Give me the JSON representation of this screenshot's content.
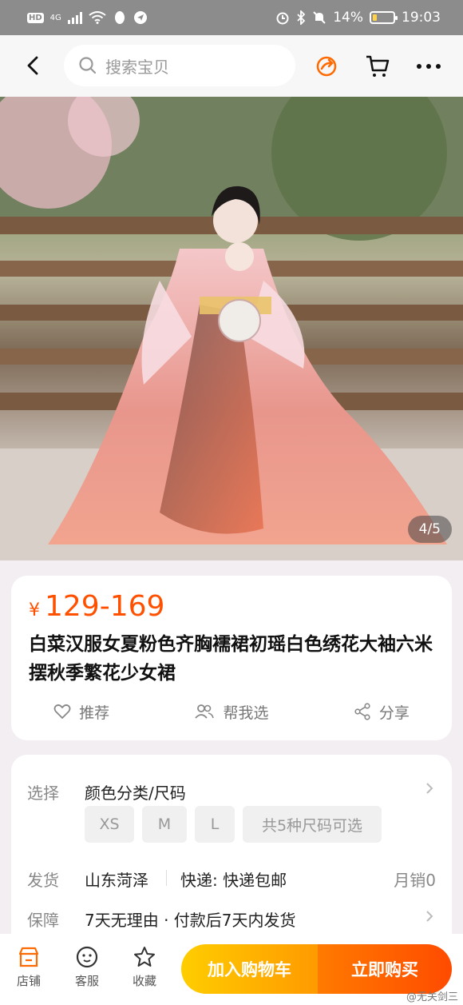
{
  "status_bar": {
    "hd": "HD",
    "network": "4G",
    "battery_percent": "14%",
    "battery_level": 0.14,
    "time": "19:03"
  },
  "header": {
    "search_placeholder": "搜索宝贝"
  },
  "gallery": {
    "counter": "4/5"
  },
  "product": {
    "currency": "¥",
    "price": "129-169",
    "title": "白菜汉服女夏粉色齐胸襦裙初瑶白色绣花大袖六米摆秋季繁花少女裙",
    "actions": [
      "推荐",
      "帮我选",
      "分享"
    ]
  },
  "spec": {
    "select_label": "选择",
    "select_value": "颜色分类/尺码",
    "sizes": [
      "XS",
      "M",
      "L"
    ],
    "sizes_more": "共5种尺码可选",
    "ship_label": "发货",
    "ship_origin": "山东菏泽",
    "ship_method": "快递: 快递包邮",
    "monthly_sales": "月销0",
    "guarantee_label": "保障",
    "guarantee_value": "7天无理由 · 付款后7天内发货"
  },
  "bottom_bar": {
    "tabs": [
      "店铺",
      "客服",
      "收藏"
    ],
    "add_to_cart": "加入购物车",
    "buy_now": "立即购买",
    "watermark": "@无关剑三"
  },
  "colors": {
    "accent": "#ff5000",
    "cart_button": "#ffb300",
    "buy_button": "#ff5a00"
  }
}
